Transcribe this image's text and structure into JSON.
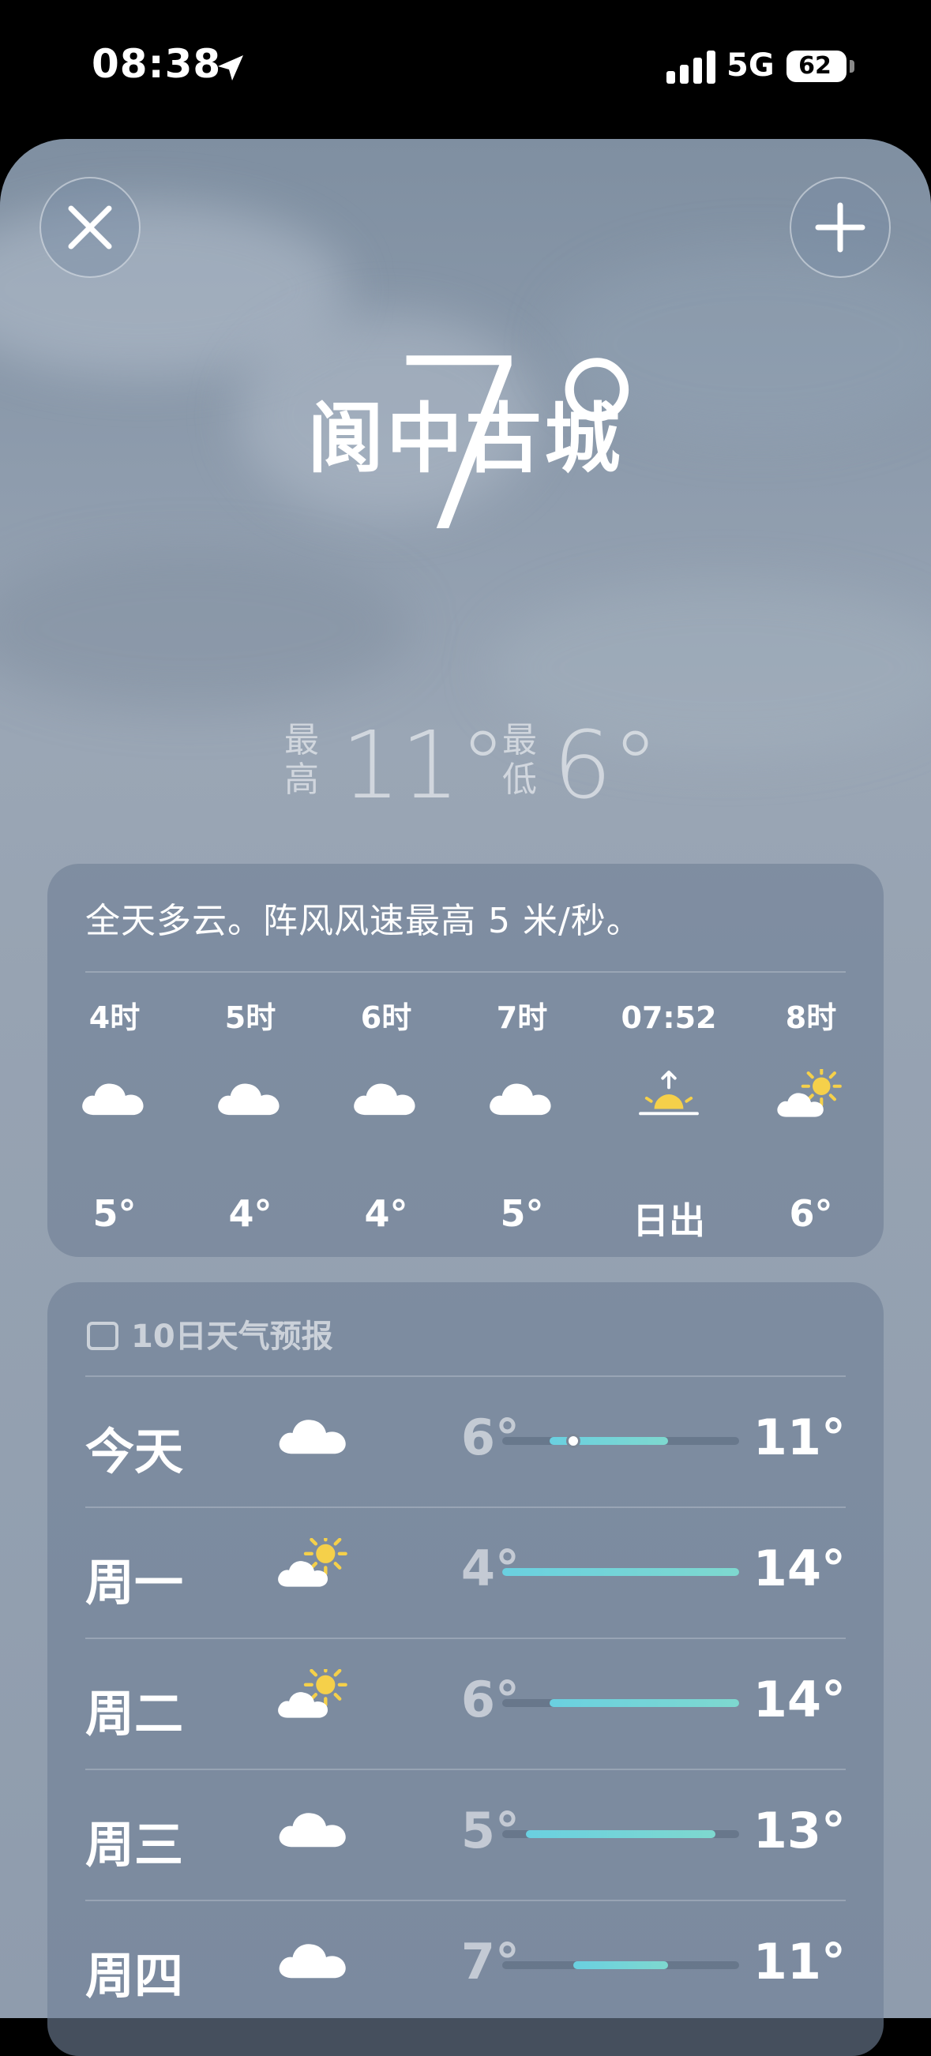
{
  "status": {
    "time": "08:38",
    "network": "5G",
    "battery": "62",
    "battery_level": 0.62
  },
  "location": {
    "name": "阆中古城"
  },
  "current": {
    "temp": "7°",
    "high_label_1": "最",
    "high_label_2": "高",
    "high_value": "11°",
    "low_label_1": "最",
    "low_label_2": "低",
    "low_value": "6°"
  },
  "hourly": {
    "summary": "全天多云。阵风风速最高 5 米/秒。",
    "items": [
      {
        "time": "4时",
        "icon": "cloud-icon",
        "temp": "5°"
      },
      {
        "time": "5时",
        "icon": "cloud-icon",
        "temp": "4°"
      },
      {
        "time": "6时",
        "icon": "cloud-icon",
        "temp": "4°"
      },
      {
        "time": "7时",
        "icon": "cloud-icon",
        "temp": "5°"
      },
      {
        "time": "07:52",
        "icon": "sunrise-icon",
        "temp": "日出"
      },
      {
        "time": "8时",
        "icon": "partly-cloudy-icon",
        "temp": "6°"
      }
    ]
  },
  "daily": {
    "header": "10日天气预报",
    "range": [
      4,
      14
    ],
    "items": [
      {
        "day": "今天",
        "icon": "cloud-icon",
        "low": "6°",
        "high": "11°",
        "low_val": 6,
        "high_val": 11,
        "current": 7
      },
      {
        "day": "周一",
        "icon": "partly-cloudy-icon",
        "low": "4°",
        "high": "14°",
        "low_val": 4,
        "high_val": 14
      },
      {
        "day": "周二",
        "icon": "partly-cloudy-icon",
        "low": "6°",
        "high": "14°",
        "low_val": 6,
        "high_val": 14
      },
      {
        "day": "周三",
        "icon": "cloud-icon",
        "low": "5°",
        "high": "13°",
        "low_val": 5,
        "high_val": 13
      },
      {
        "day": "周四",
        "icon": "cloud-icon",
        "low": "7°",
        "high": "11°",
        "low_val": 7,
        "high_val": 11
      }
    ]
  },
  "colors": {
    "sun": "#f5d04a",
    "bar_start": "#6ad0e0",
    "bar_end": "#9ed7a8"
  }
}
